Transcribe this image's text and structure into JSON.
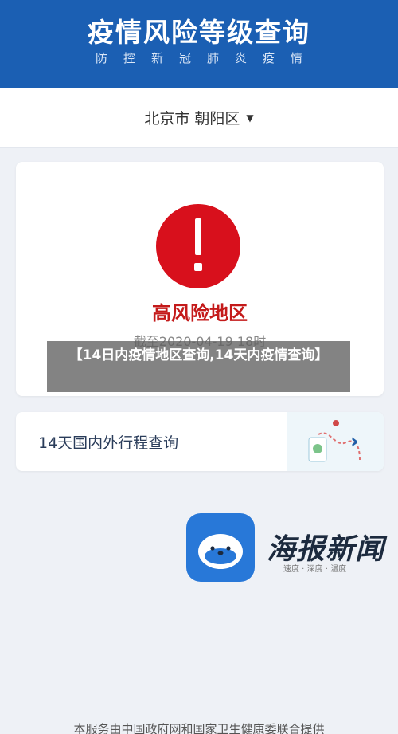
{
  "header": {
    "title": "疫情风险等级查询",
    "subtitle": "防控新冠肺炎疫情"
  },
  "region": {
    "label": "北京市 朝阳区",
    "caret": "▼"
  },
  "risk": {
    "level_label": "高风险地区",
    "date_text": "截至2020-04-19 18时",
    "color": "#d8101c"
  },
  "overlay": {
    "text": "【14日内疫情地区查询,14天内疫情查询】"
  },
  "trip": {
    "label": "14天国内外行程查询",
    "chevron": "›"
  },
  "brand": {
    "name": "海报新闻",
    "tagline": "速度 · 深度 · 温度"
  },
  "footer": {
    "text": "本服务由中国政府网和国家卫生健康委联合提供"
  },
  "colors": {
    "header_bg": "#1b5fb3",
    "accent_blue": "#2878d8"
  }
}
